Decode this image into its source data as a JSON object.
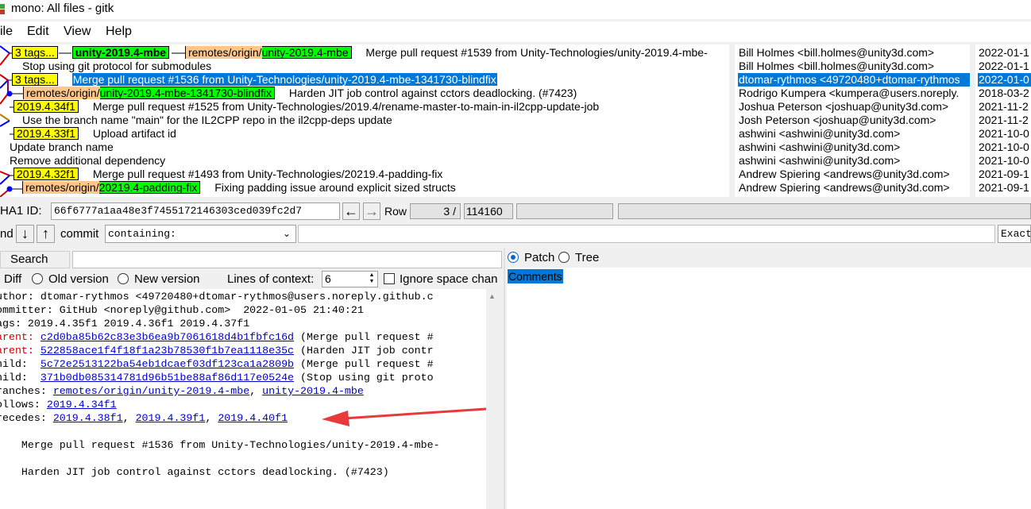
{
  "window": {
    "title": "mono: All files - gitk"
  },
  "menu": {
    "file": "ile",
    "edit": "Edit",
    "view": "View",
    "help": "Help"
  },
  "history": {
    "rows": [
      {
        "refs": [
          {
            "kind": "tag",
            "text": "3 tags..."
          },
          {
            "kind": "branch",
            "text": "unity-2019.4-mbe"
          },
          {
            "kind": "remote",
            "prefix": "remotes/origin/",
            "text": "unity-2019.4-mbe"
          }
        ],
        "message": "Merge pull request #1539 from Unity-Technologies/unity-2019.4-mbe-",
        "author": "Bill Holmes <bill.holmes@unity3d.com>",
        "date": "2022-01-1"
      },
      {
        "refs": [],
        "message": "Stop using git protocol for submodules",
        "author": "Bill Holmes <bill.holmes@unity3d.com>",
        "date": "2022-01-1"
      },
      {
        "refs": [
          {
            "kind": "tag",
            "text": "3 tags..."
          }
        ],
        "message": "Merge pull request #1536 from Unity-Technologies/unity-2019.4-mbe-1341730-blindfix",
        "author": "dtomar-rythmos <49720480+dtomar-rythmos",
        "date": "2022-01-0",
        "selected": true
      },
      {
        "refs": [
          {
            "kind": "remote",
            "prefix": "remotes/origin/",
            "text": "unity-2019.4-mbe-1341730-blindfix"
          }
        ],
        "message": "Harden JIT job control against cctors deadlocking. (#7423)",
        "author": "Rodrigo Kumpera <kumpera@users.noreply.",
        "date": "2018-03-2"
      },
      {
        "refs": [
          {
            "kind": "tag",
            "text": "2019.4.34f1"
          }
        ],
        "message": "Merge pull request #1525 from Unity-Technologies/2019.4/rename-master-to-main-in-il2cpp-update-job",
        "author": "Joshua Peterson <joshuap@unity3d.com>",
        "date": "2021-11-2"
      },
      {
        "refs": [],
        "message": "Use the branch name \"main\" for the IL2CPP repo in the il2cpp-deps update",
        "author": "Josh Peterson <joshuap@unity3d.com>",
        "date": "2021-11-2"
      },
      {
        "refs": [
          {
            "kind": "tag",
            "text": "2019.4.33f1"
          }
        ],
        "message": "Upload artifact id",
        "author": "ashwini <ashwini@unity3d.com>",
        "date": "2021-10-0"
      },
      {
        "refs": [],
        "message": "Update branch name",
        "author": "ashwini <ashwini@unity3d.com>",
        "date": "2021-10-0"
      },
      {
        "refs": [],
        "message": "Remove additional dependency",
        "author": "ashwini <ashwini@unity3d.com>",
        "date": "2021-10-0"
      },
      {
        "refs": [
          {
            "kind": "tag",
            "text": "2019.4.32f1"
          }
        ],
        "message": "Merge pull request #1493 from Unity-Technologies/20219.4-padding-fix",
        "author": "Andrew Spiering <andrews@unity3d.com>",
        "date": "2021-09-1"
      },
      {
        "refs": [
          {
            "kind": "remote",
            "prefix": "remotes/origin/",
            "text": "20219.4-padding-fix"
          }
        ],
        "message": "Fixing padding issue around explicit sized structs",
        "author": "Andrew Spiering <andrews@unity3d.com>",
        "date": "2021-09-1"
      }
    ]
  },
  "sha": {
    "label": "HA1 ID:",
    "value": "66f6777a1aa48e3f7455172146303ced039fc2d7"
  },
  "row_nav": {
    "label": "Row",
    "current": "3 /",
    "total": "114160"
  },
  "find": {
    "label": "nd",
    "commit_label": "commit",
    "mode": "containing:",
    "exact": "Exact"
  },
  "search": {
    "button": "Search"
  },
  "diff_options": {
    "diff": "Diff",
    "old": "Old version",
    "new": "New version",
    "context_label": "Lines of context:",
    "context_value": "6",
    "ignore_space": "Ignore space chan"
  },
  "view_mode": {
    "patch": "Patch",
    "tree": "Tree",
    "comments": "Comments"
  },
  "details": {
    "author_line": "uthor: dtomar-rythmos <49720480+dtomar-rythmos@users.noreply.github.c",
    "committer_line": "ommitter: GitHub <noreply@github.com>  2022-01-05 21:40:21",
    "tags_line": "ags: 2019.4.35f1 2019.4.36f1 2019.4.37f1",
    "parents": [
      {
        "label": "arent: ",
        "hash": "c2d0ba85b62c83e3b6ea9b7061618d4b1fbfc16d",
        "desc": " (Merge pull request #"
      },
      {
        "label": "arent: ",
        "hash": "522858ace1f4f18f1a23b78530f1b7ea1118e35c",
        "desc": " (Harden JIT job contr"
      }
    ],
    "children": [
      {
        "label": "hild:  ",
        "hash": "5c72e2513122ba54eb1dcaef03df123ca1a2809b",
        "desc": " (Merge pull request #"
      },
      {
        "label": "hild:  ",
        "hash": "371b0db085314781d96b51be88af86d117e0524e",
        "desc": " (Stop using git proto"
      }
    ],
    "branches_label": "ranches: ",
    "branches": [
      "remotes/origin/unity-2019.4-mbe",
      "unity-2019.4-mbe"
    ],
    "follows_label": "ollows: ",
    "follows": "2019.4.34f1",
    "precedes_label": "recedes: ",
    "precedes": [
      "2019.4.38f1",
      "2019.4.39f1",
      "2019.4.40f1"
    ],
    "message_lines": [
      "    Merge pull request #1536 from Unity-Technologies/unity-2019.4-mbe-",
      "    Harden JIT job control against cctors deadlocking. (#7423)"
    ]
  },
  "colors": {
    "selection": "#0078d7",
    "tag": "#ffff00",
    "branch": "#00ff00",
    "remote_prefix": "#ffc78a",
    "annotation_arrow": "#e83a3a"
  }
}
